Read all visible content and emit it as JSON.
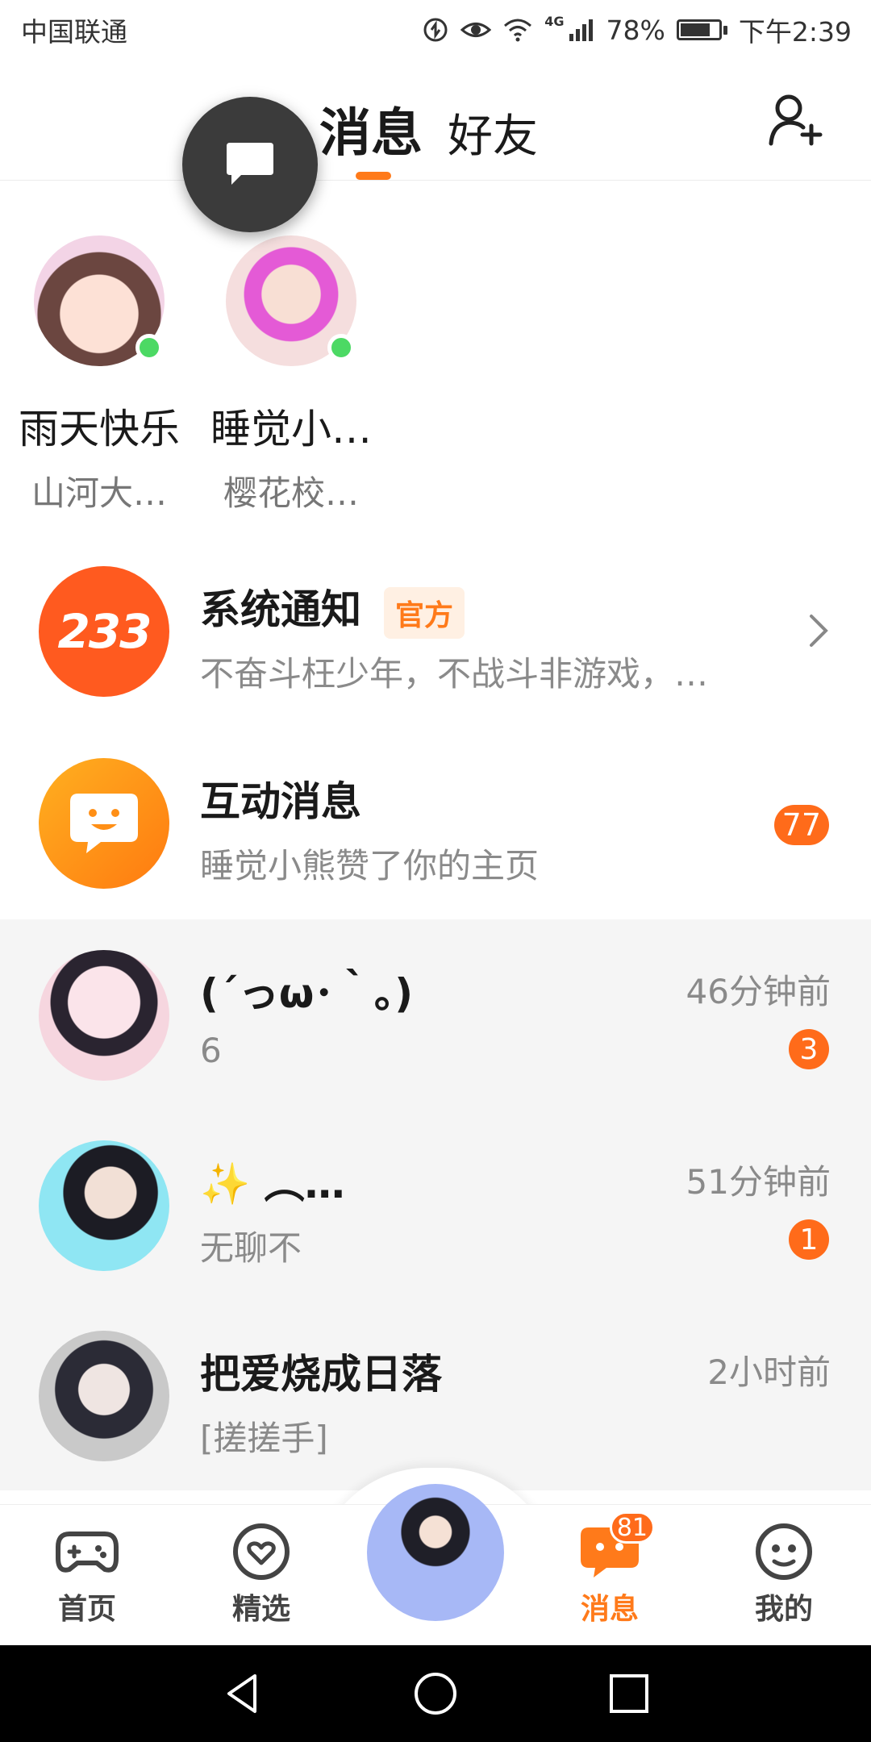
{
  "status_bar": {
    "carrier": "中国联通",
    "network": "4G",
    "battery": "78%",
    "battery_level": 0.78,
    "time": "下午2:39"
  },
  "header": {
    "tab_messages": "消息",
    "tab_friends": "好友",
    "add_friend_icon": "add-person-icon",
    "float_button_icon": "chat-bubble-icon"
  },
  "friends": [
    {
      "name": "雨天快乐",
      "subtitle": "山河大…",
      "online": true
    },
    {
      "name": "睡觉小…",
      "subtitle": "樱花校…",
      "online": true
    }
  ],
  "messages": [
    {
      "title": "系统通知",
      "tag": "官方",
      "preview": "不奋斗枉少年，不战斗非游戏，…",
      "avatar_text": "233",
      "type": "system"
    },
    {
      "title": "互动消息",
      "preview": "睡觉小熊赞了你的主页",
      "badge": "77",
      "type": "interaction"
    },
    {
      "title": "(´っω･｀｡)",
      "preview": "6",
      "time": "46分钟前",
      "badge": "3",
      "type": "chat"
    },
    {
      "title": "✨ ︵…",
      "preview": "无聊不",
      "time": "51分钟前",
      "badge": "1",
      "type": "chat"
    },
    {
      "title": "把爱烧成日落",
      "preview": "[搓搓手]",
      "time": "2小时前",
      "type": "chat"
    }
  ],
  "bottom_nav": {
    "home": "首页",
    "featured": "精选",
    "messages": "消息",
    "messages_badge": "81",
    "mine": "我的"
  },
  "colors": {
    "accent": "#ff7a1a",
    "badge": "#ff6b1a",
    "online": "#4cd964",
    "tag_bg": "#fff0e3",
    "tag_text": "#ff7a1a"
  }
}
